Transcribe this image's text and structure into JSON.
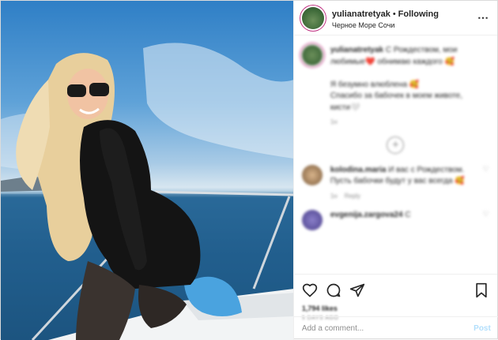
{
  "header": {
    "username": "yulianatretyak",
    "separator": "•",
    "follow_label": "Following",
    "location": "Черное Море Сочи",
    "more_icon": "⋯"
  },
  "caption": {
    "username": "yulianatretyak",
    "text_line1": "С Рождеством, мои",
    "text_line2": "любимые❤️ обнимаю каждого 🥰",
    "text_line3": "Я безумно влюблена 🥰",
    "text_line4": "Спасибо за бабочек в моем животе,",
    "text_line5": "кисти🤍",
    "age": "1н"
  },
  "comments": [
    {
      "username": "kolodina.maria",
      "text": "И вас с Рождеством. Пусть бабочки будут у вас всегда 🥰",
      "age": "1н",
      "reply_label": "Reply"
    },
    {
      "username": "evgenija.zargova24",
      "text": "С"
    }
  ],
  "actions": {
    "likes": "1,794 likes",
    "time": "5 DAYS AGO"
  },
  "add_comment": {
    "placeholder": "Add a comment...",
    "post_label": "Post"
  },
  "colors": {
    "story_ring": "#c13584",
    "post_button": "#b2dffc",
    "muted": "#8e8e8e"
  }
}
